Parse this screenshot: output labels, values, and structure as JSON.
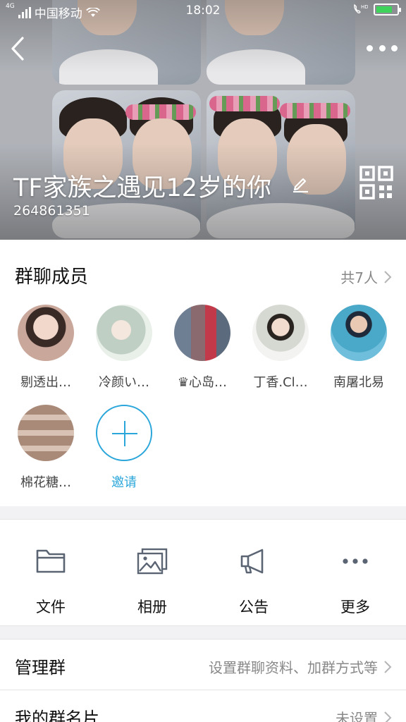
{
  "status_bar": {
    "carrier": "中国移动",
    "time": "18:02",
    "network": "4G"
  },
  "header": {
    "group_name": "TF家族之遇见12岁的你",
    "group_id": "264861351"
  },
  "members": {
    "title": "群聊成员",
    "count_label": "共7人",
    "items": [
      {
        "name": "剔透出…",
        "avatar_color": "#c9a79a"
      },
      {
        "name": "冷颜い…",
        "avatar_color": "#bfcfc4"
      },
      {
        "name": "♛心岛…",
        "avatar_color": "#8a6a6e"
      },
      {
        "name": "丁香.Cl…",
        "avatar_color": "#d6d8d2"
      },
      {
        "name": "南屠北易",
        "avatar_color": "#4aa8c8"
      },
      {
        "name": "棉花糖…",
        "avatar_color": "#a98a78"
      }
    ],
    "invite_label": "邀请"
  },
  "tools": [
    {
      "label": "文件",
      "icon": "folder-icon"
    },
    {
      "label": "相册",
      "icon": "album-icon"
    },
    {
      "label": "公告",
      "icon": "megaphone-icon"
    },
    {
      "label": "更多",
      "icon": "more-dots-icon"
    }
  ],
  "settings": {
    "manage": {
      "label": "管理群",
      "value": "设置群聊资料、加群方式等"
    },
    "card": {
      "label": "我的群名片",
      "value": "未设置"
    }
  },
  "colors": {
    "accent": "#2aa6da",
    "battery": "#3ed35a"
  }
}
